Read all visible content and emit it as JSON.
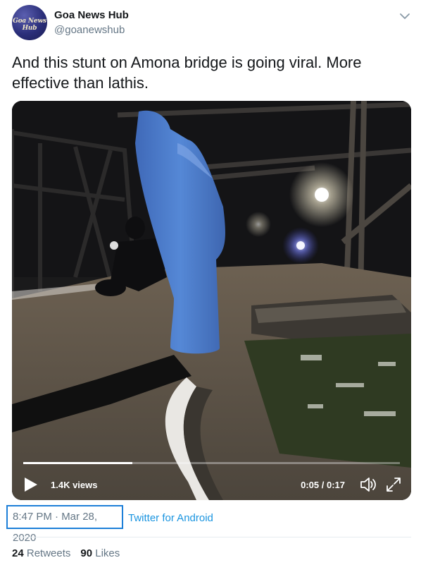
{
  "author": {
    "display_name": "Goa News Hub",
    "handle": "@goanewshub",
    "avatar_text": "Goa News Hub"
  },
  "tweet": {
    "text": "And this stunt on Amona bridge is going viral. More effective than lathis."
  },
  "video": {
    "views": "1.4K views",
    "time": "0:05 / 0:17",
    "progress_fraction": 0.29
  },
  "meta": {
    "timestamp": "8:47 PM · Mar 28, 2020",
    "source": "Twitter for Android"
  },
  "stats": {
    "retweets_count": "24",
    "retweets_label": "Retweets",
    "likes_count": "90",
    "likes_label": "Likes"
  },
  "colors": {
    "link": "#1b95e0",
    "muted": "#657786",
    "highlight_box": "#1d7fd8"
  },
  "icons": [
    "chevron-down-icon",
    "play-icon",
    "volume-icon",
    "fullscreen-icon"
  ]
}
